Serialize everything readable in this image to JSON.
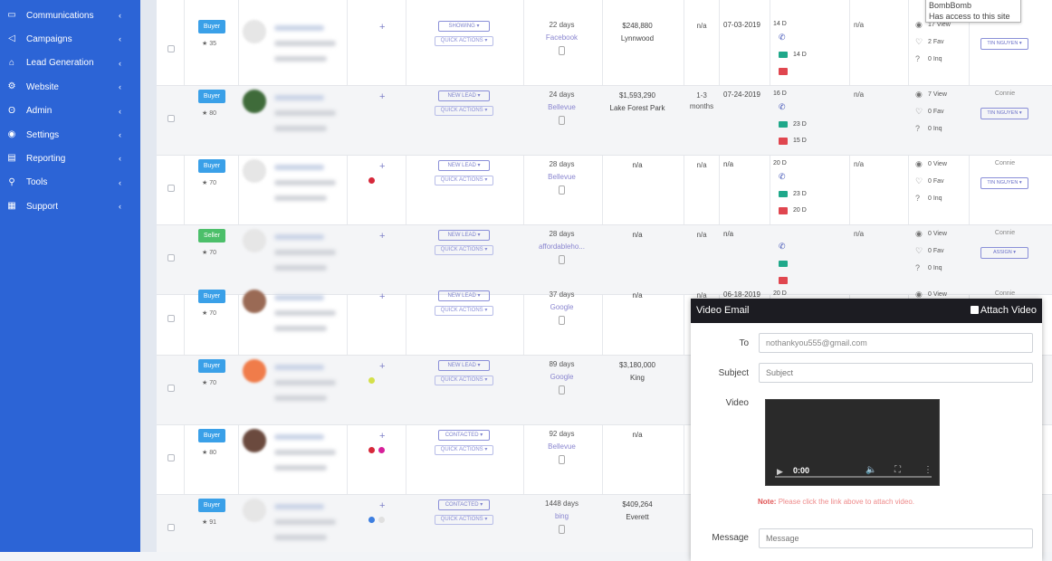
{
  "sidebar": {
    "items": [
      {
        "label": "Communications",
        "icon": "chat-icon"
      },
      {
        "label": "Campaigns",
        "icon": "megaphone-icon"
      },
      {
        "label": "Lead Generation",
        "icon": "home-icon"
      },
      {
        "label": "Website",
        "icon": "gear-icon"
      },
      {
        "label": "Admin",
        "icon": "users-icon"
      },
      {
        "label": "Settings",
        "icon": "settings-icon"
      },
      {
        "label": "Reporting",
        "icon": "report-icon"
      },
      {
        "label": "Tools",
        "icon": "wrench-icon"
      },
      {
        "label": "Support",
        "icon": "support-icon"
      }
    ],
    "chevron": "‹"
  },
  "quick_actions_label": "QUICK ACTIONS ▾",
  "rows": [
    {
      "badge": "Buyer",
      "badge_color": "#3aa0e8",
      "score": "★ 35",
      "status": "SHOWING ▾",
      "days": "22 days",
      "source": "Facebook",
      "price": "$248,880",
      "area": "Lynnwood",
      "timeframe": "n/a",
      "date": "07-03-2019",
      "act_days": "14 D",
      "mail": "14 D",
      "chat": "",
      "col10": "n/a",
      "views": "17 View",
      "favs": "2 Fav",
      "inqs": "0 Inq",
      "agent_name": "",
      "agent": "TIN NGUYEN ▾"
    },
    {
      "badge": "Buyer",
      "badge_color": "#3aa0e8",
      "score": "★ 80",
      "status": "NEW LEAD ▾",
      "days": "24 days",
      "source": "Bellevue",
      "price": "$1,593,290",
      "area": "Lake Forest Park",
      "timeframe": "1-3 months",
      "date": "07-24-2019",
      "act_days": "16 D",
      "mail": "23 D",
      "chat": "15 D",
      "col10": "n/a",
      "views": "7 View",
      "favs": "0 Fav",
      "inqs": "0 Inq",
      "agent_name": "Connie",
      "agent": "TIN NGUYEN ▾"
    },
    {
      "badge": "Buyer",
      "badge_color": "#3aa0e8",
      "score": "★ 70",
      "status": "NEW LEAD ▾",
      "days": "28 days",
      "source": "Bellevue",
      "price": "n/a",
      "area": "",
      "timeframe": "n/a",
      "date": "n/a",
      "act_days": "20 D",
      "mail": "23 D",
      "chat": "20 D",
      "col10": "n/a",
      "views": "0 View",
      "favs": "0 Fav",
      "inqs": "0 Inq",
      "agent_name": "Connie",
      "agent": "TIN NGUYEN ▾"
    },
    {
      "badge": "Seller",
      "badge_color": "#4cbf6a",
      "score": "★ 70",
      "status": "NEW LEAD ▾",
      "days": "28 days",
      "source": "affordablehо...",
      "price": "n/a",
      "area": "",
      "timeframe": "n/a",
      "date": "n/a",
      "act_days": "",
      "mail": "",
      "chat": "",
      "col10": "n/a",
      "views": "0 View",
      "favs": "0 Fav",
      "inqs": "0 Inq",
      "agent_name": "Connie",
      "agent": "ASSIGN ▾"
    },
    {
      "badge": "Buyer",
      "badge_color": "#3aa0e8",
      "score": "★ 70",
      "status": "NEW LEAD ▾",
      "days": "37 days",
      "source": "Google",
      "price": "n/a",
      "area": "",
      "timeframe": "n/a",
      "date": "06-18-2019",
      "act_days": "20 D",
      "mail": "",
      "chat": "",
      "col10": "",
      "views": "0 View",
      "favs": "",
      "inqs": "",
      "agent_name": "Connie",
      "agent": ""
    },
    {
      "badge": "Buyer",
      "badge_color": "#3aa0e8",
      "score": "★ 70",
      "status": "NEW LEAD ▾",
      "days": "89 days",
      "source": "Google",
      "price": "$3,180,000",
      "area": "King",
      "timeframe": "",
      "date": "",
      "act_days": "",
      "mail": "",
      "chat": "",
      "col10": "",
      "views": "",
      "favs": "",
      "inqs": "",
      "agent_name": "",
      "agent": ""
    },
    {
      "badge": "Buyer",
      "badge_color": "#3aa0e8",
      "score": "★ 80",
      "status": "CONTACTED ▾",
      "days": "92 days",
      "source": "Bellevue",
      "price": "n/a",
      "area": "",
      "timeframe": "",
      "date": "",
      "act_days": "",
      "mail": "",
      "chat": "",
      "col10": "",
      "views": "",
      "favs": "",
      "inqs": "",
      "agent_name": "",
      "agent": ""
    },
    {
      "badge": "Buyer",
      "badge_color": "#3aa0e8",
      "score": "★ 91",
      "status": "CONTACTED ▾",
      "days": "1448 days",
      "source": "bing",
      "price": "$409,264",
      "area": "Everett",
      "timeframe": "",
      "date": "",
      "act_days": "",
      "mail": "",
      "chat": "",
      "col10": "",
      "views": "",
      "favs": "",
      "inqs": "",
      "agent_name": "",
      "agent": ""
    }
  ],
  "tooltip": {
    "line1": "BombBomb",
    "line2": "Has access to this site"
  },
  "modal": {
    "title": "Video Email",
    "attach_label": "Attach Video",
    "to_label": "To",
    "to_value": "nothankyou555@gmail.com",
    "subject_label": "Subject",
    "subject_placeholder": "Subject",
    "video_label": "Video",
    "video_time": "0:00",
    "note_prefix": "Note:",
    "note_text": "Please click the link above to attach video.",
    "message_label": "Message",
    "message_placeholder": "Message"
  }
}
